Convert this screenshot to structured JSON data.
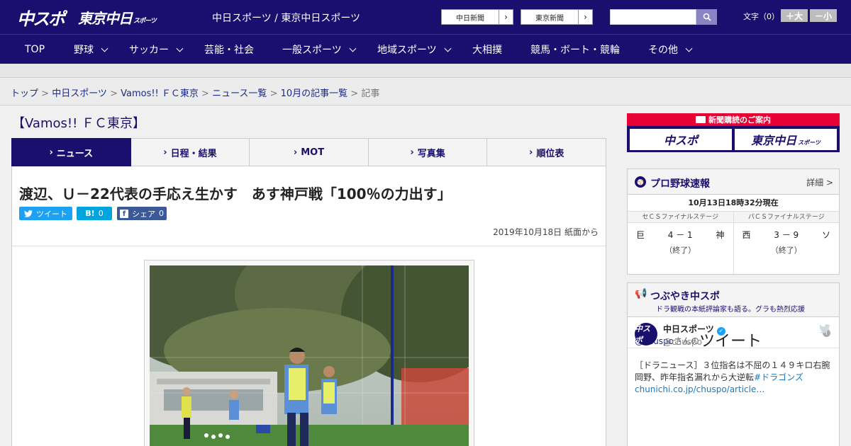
{
  "header": {
    "logo_chuspo": "中スポ",
    "logo_tokyo": "東京中日",
    "logo_tokyo_sub": "スポーツ",
    "site_title": "中日スポーツ / 東京中日スポーツ",
    "newspaper_buttons": [
      {
        "label": "中日新聞"
      },
      {
        "label": "東京新聞"
      }
    ],
    "search": {
      "placeholder": ""
    },
    "font_size_label": "文字（0）",
    "font_plus": "＋大",
    "font_minus": "－小"
  },
  "nav": {
    "items": [
      {
        "label": "TOP",
        "has_menu": false
      },
      {
        "label": "野球",
        "has_menu": true
      },
      {
        "label": "サッカー",
        "has_menu": true
      },
      {
        "label": "芸能・社会",
        "has_menu": false
      },
      {
        "label": "一般スポーツ",
        "has_menu": true
      },
      {
        "label": "地域スポーツ",
        "has_menu": true
      },
      {
        "label": "大相撲",
        "has_menu": false
      },
      {
        "label": "競馬・ボート・競輪",
        "has_menu": false
      },
      {
        "label": "その他",
        "has_menu": true
      }
    ]
  },
  "breadcrumb": {
    "items": [
      "トップ",
      "中日スポーツ",
      "Vamos!! ＦＣ東京",
      "ニュース一覧",
      "10月の記事一覧"
    ],
    "current": "記事",
    "separator": " > "
  },
  "section": {
    "title": "【Vamos!! ＦＣ東京】",
    "tabs": [
      {
        "label": "ニュース",
        "active": true
      },
      {
        "label": "日程・結果",
        "active": false
      },
      {
        "label": "MOT",
        "active": false
      },
      {
        "label": "写真集",
        "active": false
      },
      {
        "label": "順位表",
        "active": false
      }
    ]
  },
  "article": {
    "headline": "渡辺、Ｕ－22代表の手応え生かす　あす神戸戦「100％の力出す」",
    "share": {
      "tweet": "ツイート",
      "hatena": "B!",
      "hatena_count": "0",
      "facebook": "シェア",
      "facebook_count": "0"
    },
    "date": "2019年10月18日 紙面から"
  },
  "sidebar": {
    "subscribe": {
      "title": "新聞購読のご案内",
      "logo_chuspo": "中スポ",
      "logo_tokyo": "東京中日",
      "logo_tokyo_sub": "スポーツ"
    },
    "baseball": {
      "title": "プロ野球速報",
      "detail": "詳細 >",
      "timestamp": "10月13日18時32分現在",
      "games": [
        {
          "stage": "セＣＳファイナルステージ",
          "home": "巨",
          "score": "4 － 1",
          "away": "神",
          "status": "（終了）"
        },
        {
          "stage": "パＣＳファイナルステージ",
          "home": "西",
          "score": "3 － 9",
          "away": "ソ",
          "status": "（終了）"
        }
      ]
    },
    "tweets": {
      "title": "つぶやき中スポ",
      "subtitle": "ドラ観戦の本紙評論家も語る。グラも熱烈応援",
      "user_link": "@chuspo",
      "user_suffix": "さんの",
      "timeline_word": "ツイート",
      "tweet": {
        "avatar_text": "中スポ",
        "name": "中日スポーツ",
        "handle": "@chuspo",
        "text": "［ドラニュース］３位指名は不屈の１４９キロ右腕　岡野、昨年指名漏れから大逆転",
        "hashtag": "#ドラゴンズ",
        "link": "chunichi.co.jp/chuspo/article…"
      }
    }
  }
}
